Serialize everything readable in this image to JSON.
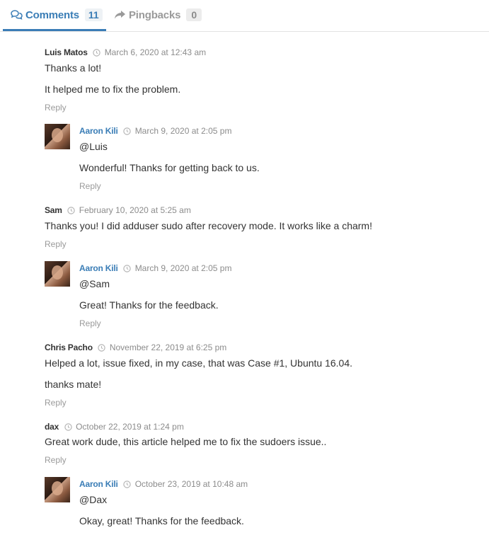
{
  "tabs": {
    "comments": {
      "label": "Comments",
      "count": "11",
      "icon": "comments-icon"
    },
    "pingbacks": {
      "label": "Pingbacks",
      "count": "0",
      "icon": "share-arrow-icon"
    }
  },
  "accent_color": "#3a7db6",
  "comments": [
    {
      "author": "Luis Matos",
      "date": "March 6, 2020 at 12:43 am",
      "lines": [
        "Thanks a lot!",
        "It helped me to fix the problem."
      ],
      "reply": "Reply"
    },
    {
      "author": "Aaron Kili",
      "date": "March 9, 2020 at 2:05 pm",
      "lines": [
        "@Luis",
        "Wonderful! Thanks for getting back to us."
      ],
      "reply": "Reply"
    },
    {
      "author": "Sam",
      "date": "February 10, 2020 at 5:25 am",
      "lines": [
        "Thanks you! I did adduser sudo after recovery mode. It works like a charm!"
      ],
      "reply": "Reply"
    },
    {
      "author": "Aaron Kili",
      "date": "March 9, 2020 at 2:05 pm",
      "lines": [
        "@Sam",
        "Great! Thanks for the feedback."
      ],
      "reply": "Reply"
    },
    {
      "author": "Chris Pacho",
      "date": "November 22, 2019 at 6:25 pm",
      "lines": [
        "Helped a lot, issue fixed, in my case, that was Case #1, Ubuntu 16.04.",
        "thanks mate!"
      ],
      "reply": "Reply"
    },
    {
      "author": "dax",
      "date": "October 22, 2019 at 1:24 pm",
      "lines": [
        "Great work dude, this article helped me to fix the sudoers issue.."
      ],
      "reply": "Reply"
    },
    {
      "author": "Aaron Kili",
      "date": "October 23, 2019 at 10:48 am",
      "lines": [
        "@Dax",
        "Okay, great! Thanks for the feedback."
      ]
    }
  ]
}
